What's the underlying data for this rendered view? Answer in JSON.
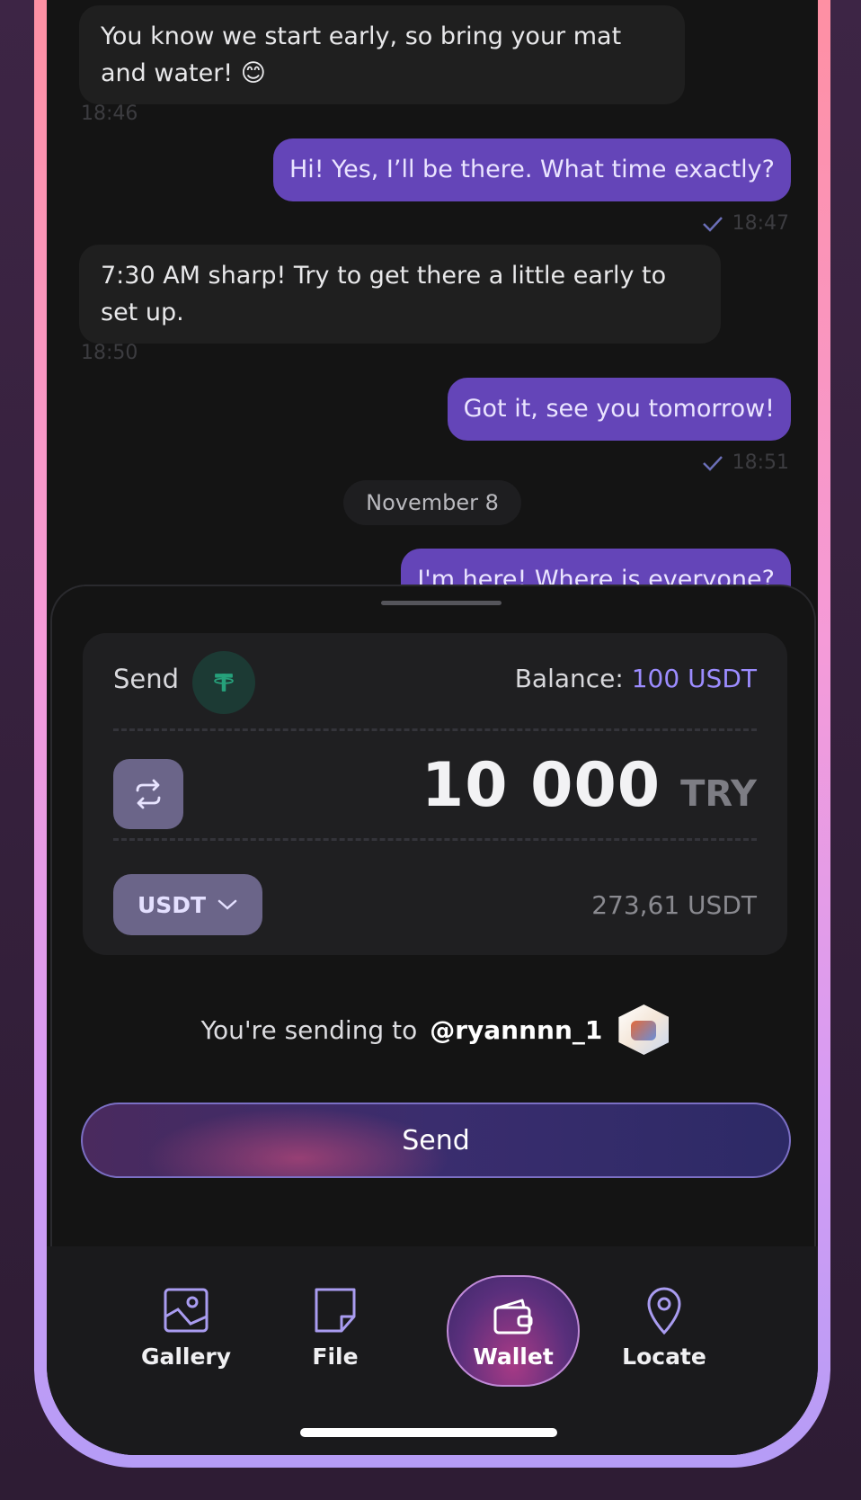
{
  "messages": [
    {
      "dir": "in",
      "text_line1": "You know we start early, so bring your mat",
      "text_line2": "and water! 😊",
      "time": "18:46"
    },
    {
      "dir": "out",
      "text": "Hi! Yes, I’ll be there. What time exactly?",
      "time": "18:47"
    },
    {
      "dir": "in",
      "text_line1": "7:30 AM sharp! Try to get there a little early to",
      "text_line2": "set up.",
      "time": "18:50"
    },
    {
      "dir": "out",
      "text": "Got it, see you tomorrow!",
      "time": "18:51"
    },
    {
      "dir": "out",
      "text": "I'm here! Where is everyone?"
    }
  ],
  "date_separator": "November 8",
  "send_sheet": {
    "send_label": "Send",
    "token_icon": "tether-icon",
    "balance_label": "Balance:",
    "balance_value": "100 USDT",
    "amount": "10 000",
    "amount_currency": "TRY",
    "currency_selected": "USDT",
    "converted_amount": "273,61 USDT",
    "recipient_prefix": "You're sending to",
    "recipient_handle": "@ryannnn_1",
    "send_button_label": "Send"
  },
  "bottom_tabs": [
    {
      "label": "Gallery",
      "icon": "gallery-icon"
    },
    {
      "label": "File",
      "icon": "file-icon"
    },
    {
      "label": "Wallet",
      "icon": "wallet-icon",
      "active": true
    },
    {
      "label": "Locate",
      "icon": "location-pin-icon"
    }
  ],
  "colors": {
    "outgoing_bubble": "#6445b8",
    "incoming_bubble": "#1f1f1f",
    "accent": "#9c8cff",
    "token_green": "#26a17b"
  }
}
